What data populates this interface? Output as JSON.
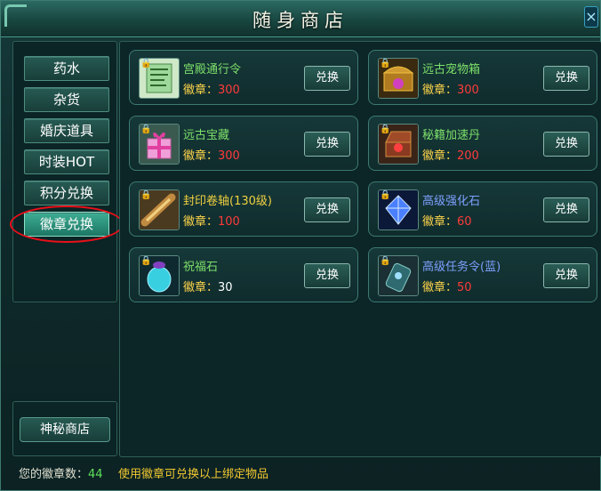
{
  "window": {
    "title": "随身商店",
    "close_label": "×"
  },
  "sidebar": {
    "categories": [
      {
        "label": "药水"
      },
      {
        "label": "杂货"
      },
      {
        "label": "婚庆道具"
      },
      {
        "label": "时装HOT"
      },
      {
        "label": "积分兑换"
      },
      {
        "label": "徽章兑换",
        "active": true
      }
    ],
    "mystery_shop_label": "神秘商店"
  },
  "items": [
    {
      "name": "宫殿通行令",
      "price_label": "徽章：",
      "price": "300",
      "button": "兑换",
      "icon": "scroll-icon"
    },
    {
      "name": "远古宠物箱",
      "price_label": "徽章：",
      "price": "300",
      "button": "兑换",
      "icon": "treasure-chest-icon"
    },
    {
      "name": "远古宝藏",
      "price_label": "徽章：",
      "price": "300",
      "button": "兑换",
      "icon": "gift-box-icon"
    },
    {
      "name": "秘籍加速丹",
      "price_label": "徽章：",
      "price": "200",
      "button": "兑换",
      "icon": "jewel-box-icon"
    },
    {
      "name": "封印卷轴(130级)",
      "price_label": "徽章：",
      "price": "100",
      "button": "兑换",
      "icon": "sealed-scroll-icon"
    },
    {
      "name": "高级强化石",
      "price_label": "徽章：",
      "price": "60",
      "button": "兑换",
      "icon": "crystal-icon"
    },
    {
      "name": "祝福石",
      "price_label": "徽章：",
      "price": "30",
      "button": "兑换",
      "icon": "blessing-stone-icon"
    },
    {
      "name": "高级任务令(蓝)",
      "price_label": "徽章：",
      "price": "50",
      "button": "兑换",
      "icon": "task-token-icon"
    }
  ],
  "footer": {
    "badge_count_label": "您的徽章数：",
    "badge_count": "44",
    "note": "使用徽章可兑换以上绑定物品"
  },
  "colors": {
    "item_name_green": "#7de06a",
    "item_name_blue": "#7ea0ff",
    "item_name_yellow": "#f0d040",
    "price_red": "#ff3a3a",
    "highlight_ring": "#e8101a"
  }
}
